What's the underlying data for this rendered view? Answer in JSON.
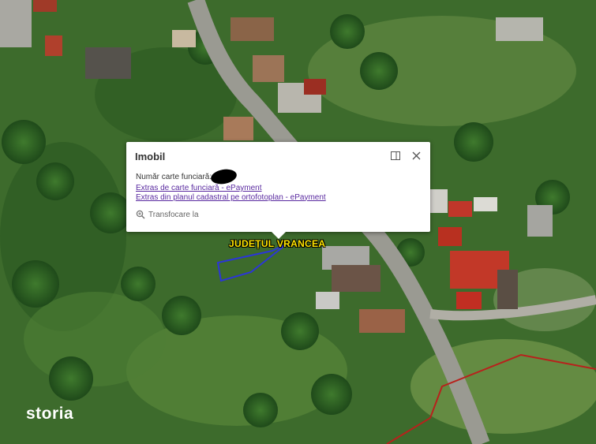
{
  "popup": {
    "title": "Imobil",
    "field_label": "Număr carte funciară:",
    "link_extras_cf": "Extras de carte funciară - ePayment",
    "link_extras_plan": "Extras din planul cadastral pe ortofotoplan - ePayment",
    "zoom_label": "Transfocare la",
    "maximize_icon": "maximize-icon",
    "close_icon": "close-icon",
    "zoom_icon": "magnifier-icon"
  },
  "map": {
    "county_label": "JUDEȚUL VRANCEA",
    "watermark": "storia",
    "colors": {
      "parcel_outline": "#2b35d9",
      "boundary_line": "#b8211c",
      "county_text": "#ffe500"
    }
  }
}
